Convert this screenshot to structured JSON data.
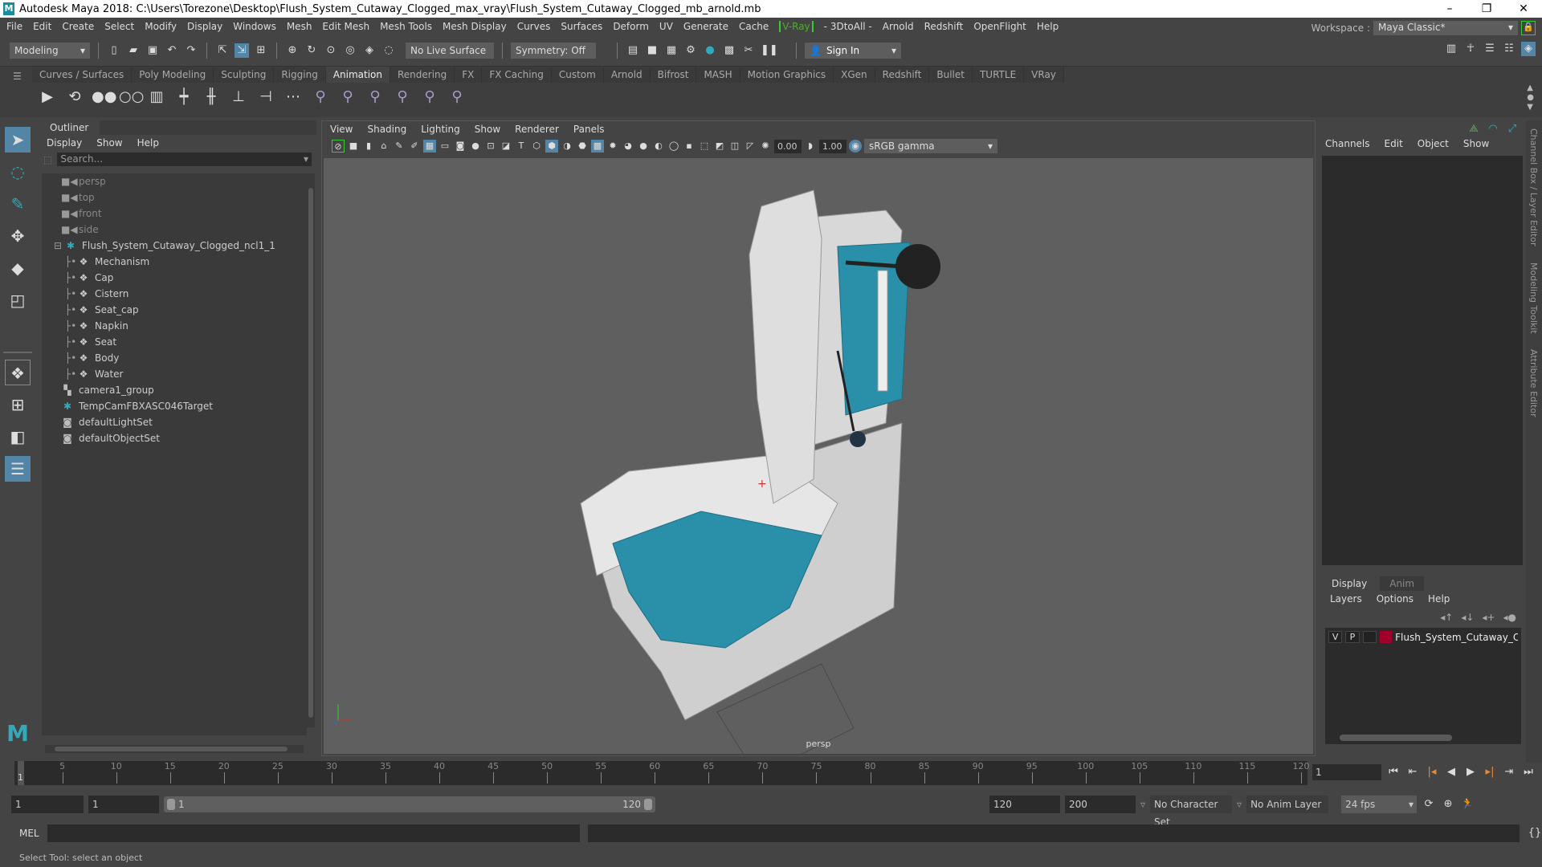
{
  "window": {
    "title": "Autodesk Maya 2018: C:\\Users\\Torezone\\Desktop\\Flush_System_Cutaway_Clogged_max_vray\\Flush_System_Cutaway_Clogged_mb_arnold.mb",
    "controls": [
      "–",
      "❐",
      "✕"
    ]
  },
  "menubar": [
    "File",
    "Edit",
    "Create",
    "Select",
    "Modify",
    "Display",
    "Windows",
    "Mesh",
    "Edit Mesh",
    "Mesh Tools",
    "Mesh Display",
    "Curves",
    "Surfaces",
    "Deform",
    "UV",
    "Generate",
    "Cache",
    "V-Ray",
    "- 3DtoAll -",
    "Arnold",
    "Redshift",
    "OpenFlight",
    "Help"
  ],
  "workspace": {
    "label": "Workspace :",
    "value": "Maya Classic*"
  },
  "statusline": {
    "mode": "Modeling",
    "live_surface": "No Live Surface",
    "symmetry": "Symmetry: Off",
    "sign_in": "Sign In"
  },
  "shelf": {
    "tabs": [
      "Curves / Surfaces",
      "Poly Modeling",
      "Sculpting",
      "Rigging",
      "Animation",
      "Rendering",
      "FX",
      "FX Caching",
      "Custom",
      "Arnold",
      "Bifrost",
      "MASH",
      "Motion Graphics",
      "XGen",
      "Redshift",
      "Bullet",
      "TURTLE",
      "VRay"
    ],
    "active": "Animation",
    "icons": [
      "playblast-icon",
      "motion-trail-icon",
      "ghost-icon",
      "unghost-icon",
      "timeline-icon",
      "set-key-icon",
      "key-translate-icon",
      "key-rotate-icon",
      "key-scale-icon",
      "breakdown-icon",
      "constraint-parent-icon",
      "constraint-point-icon",
      "constraint-orient-icon",
      "constraint-scale-icon",
      "constraint-aim-icon",
      "constraint-pole-icon"
    ]
  },
  "outliner": {
    "title": "Outliner",
    "menu": [
      "Display",
      "Show",
      "Help"
    ],
    "search_placeholder": "Search...",
    "items": [
      {
        "label": "persp",
        "type": "camera",
        "level": 1,
        "dim": true
      },
      {
        "label": "top",
        "type": "camera",
        "level": 1,
        "dim": true
      },
      {
        "label": "front",
        "type": "camera",
        "level": 1,
        "dim": true
      },
      {
        "label": "side",
        "type": "camera",
        "level": 1,
        "dim": true
      },
      {
        "label": "Flush_System_Cutaway_Clogged_ncl1_1",
        "type": "locator",
        "level": 0,
        "expanded": true
      },
      {
        "label": "Mechanism",
        "type": "mesh",
        "level": 2
      },
      {
        "label": "Cap",
        "type": "mesh",
        "level": 2
      },
      {
        "label": "Cistern",
        "type": "mesh",
        "level": 2
      },
      {
        "label": "Seat_cap",
        "type": "mesh",
        "level": 2
      },
      {
        "label": "Napkin",
        "type": "mesh",
        "level": 2
      },
      {
        "label": "Seat",
        "type": "mesh",
        "level": 2
      },
      {
        "label": "Body",
        "type": "mesh",
        "level": 2
      },
      {
        "label": "Water",
        "type": "mesh",
        "level": 2
      },
      {
        "label": "camera1_group",
        "type": "group",
        "level": 1
      },
      {
        "label": "TempCamFBXASC046Target",
        "type": "locator",
        "level": 1
      },
      {
        "label": "defaultLightSet",
        "type": "set",
        "level": 1
      },
      {
        "label": "defaultObjectSet",
        "type": "set",
        "level": 1
      }
    ]
  },
  "viewport": {
    "menu": [
      "View",
      "Shading",
      "Lighting",
      "Show",
      "Renderer",
      "Panels"
    ],
    "exposure": "0.00",
    "gamma": "1.00",
    "color_space": "sRGB gamma",
    "camera": "persp"
  },
  "channelbox": {
    "menu": [
      "Channels",
      "Edit",
      "Object",
      "Show"
    ]
  },
  "side_tabs": [
    "Channel Box / Layer Editor",
    "Modeling Toolkit",
    "Attribute Editor"
  ],
  "layer_editor": {
    "tabs": [
      "Display",
      "Anim"
    ],
    "active": "Display",
    "menu": [
      "Layers",
      "Options",
      "Help"
    ],
    "layers": [
      {
        "v": "V",
        "p": "P",
        "color": "#a0002a",
        "name": "Flush_System_Cutaway_Clogged"
      }
    ]
  },
  "timeline": {
    "start": 1,
    "end": 120,
    "current": "1",
    "tick_step": 5
  },
  "range": {
    "start": "1",
    "anim_start": "1",
    "range_start": "1",
    "range_end": "120",
    "end": "120",
    "anim_end": "200",
    "character_set": "No Character Set",
    "anim_layer": "No Anim Layer",
    "fps": "24 fps"
  },
  "mel": {
    "label": "MEL"
  },
  "help_line": "Select Tool: select an object",
  "colors": {
    "accent": "#5285a6",
    "water": "#2a8fa8",
    "layer": "#a0002a"
  }
}
